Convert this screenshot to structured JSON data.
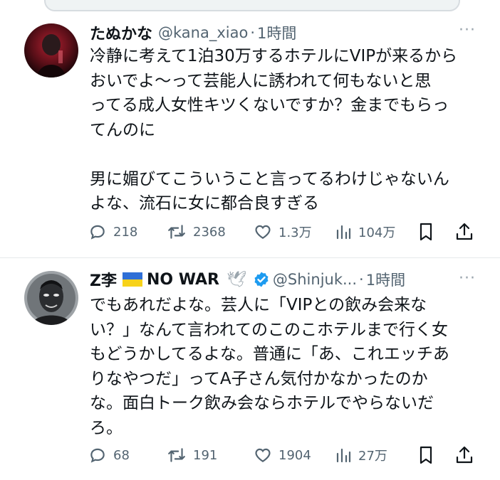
{
  "tweets": [
    {
      "display_name": "たぬかな",
      "handle": "@kana_xiao",
      "separator": "·",
      "time": "1時間",
      "more": "···",
      "text": "冷静に考えて1泊30万するホテルにVIPが来るから\nおいでよ〜って芸能人に誘われて何もないと思\nってる成人女性キツくないですか？金までもらっ\nてんのに\n\n男に媚びてこういうこと言ってるわけじゃないん\nよな、流石に女に都合良すぎる",
      "stats": {
        "replies": "218",
        "retweets": "2368",
        "likes": "1.3万",
        "views": "104万"
      }
    },
    {
      "display_name": "Z李",
      "flag": "ukraine-flag",
      "name_suffix": "NO WAR",
      "dove": "🕊",
      "handle": "@Shinjuk...",
      "separator": "·",
      "time": "1時間",
      "more": "···",
      "text": "でもあれだよな。芸人に「VIPとの飲み会来な\nい？」なんて言われてのこのこホテルまで行く女\nもどうかしてるよな。普通に「あ、これエッチあ\nりなやつだ」ってA子さん気付かなかったのか\nな。面白トーク飲み会ならホテルでやらないだ\nろ。",
      "stats": {
        "replies": "68",
        "retweets": "191",
        "likes": "1904",
        "views": "27万"
      }
    }
  ],
  "colors": {
    "text": "#0f1419",
    "secondary": "#536471",
    "verified": "#1d9bf0",
    "divider": "#e6e9eb"
  }
}
